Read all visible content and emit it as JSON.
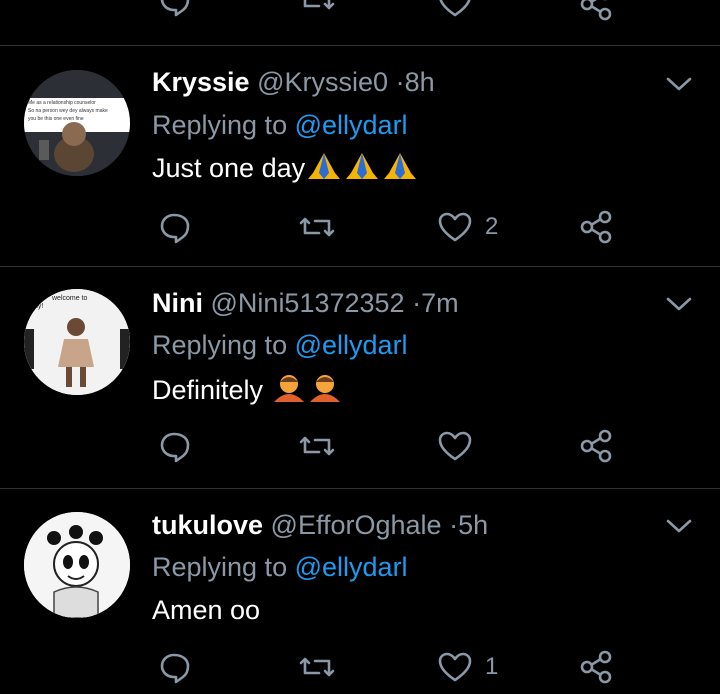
{
  "tweets": [
    {
      "name": "Kryssie",
      "handle": "@Kryssie0",
      "time": "8h",
      "replying_prefix": "Replying to",
      "mention": "@ellydarl",
      "text": "Just one day",
      "emoji": [
        "folded-hands",
        "folded-hands",
        "folded-hands"
      ],
      "likes": "2",
      "avatar_text": [
        "Me as a relationship counselor",
        "So na person wey dey always make",
        "you be this one even fine"
      ]
    },
    {
      "name": "Nini",
      "handle": "@Nini51372352",
      "time": "7m",
      "replying_prefix": "Replying to",
      "mention": "@ellydarl",
      "text": "Definitely",
      "emoji": [
        "person-bowing",
        "person-bowing"
      ],
      "likes": "",
      "avatar_text": [
        "welcome to",
        "ny!"
      ]
    },
    {
      "name": "tukulove",
      "handle": "@EfforOghale",
      "time": "5h",
      "replying_prefix": "Replying to",
      "mention": "@ellydarl",
      "text": "Amen oo",
      "emoji": [],
      "likes": "1",
      "avatar_text": []
    }
  ],
  "separator_dot": "·",
  "colors": {
    "background": "#000000",
    "secondary": "#8b98a5",
    "link": "#1d9bf0",
    "divider": "#2f3336"
  }
}
